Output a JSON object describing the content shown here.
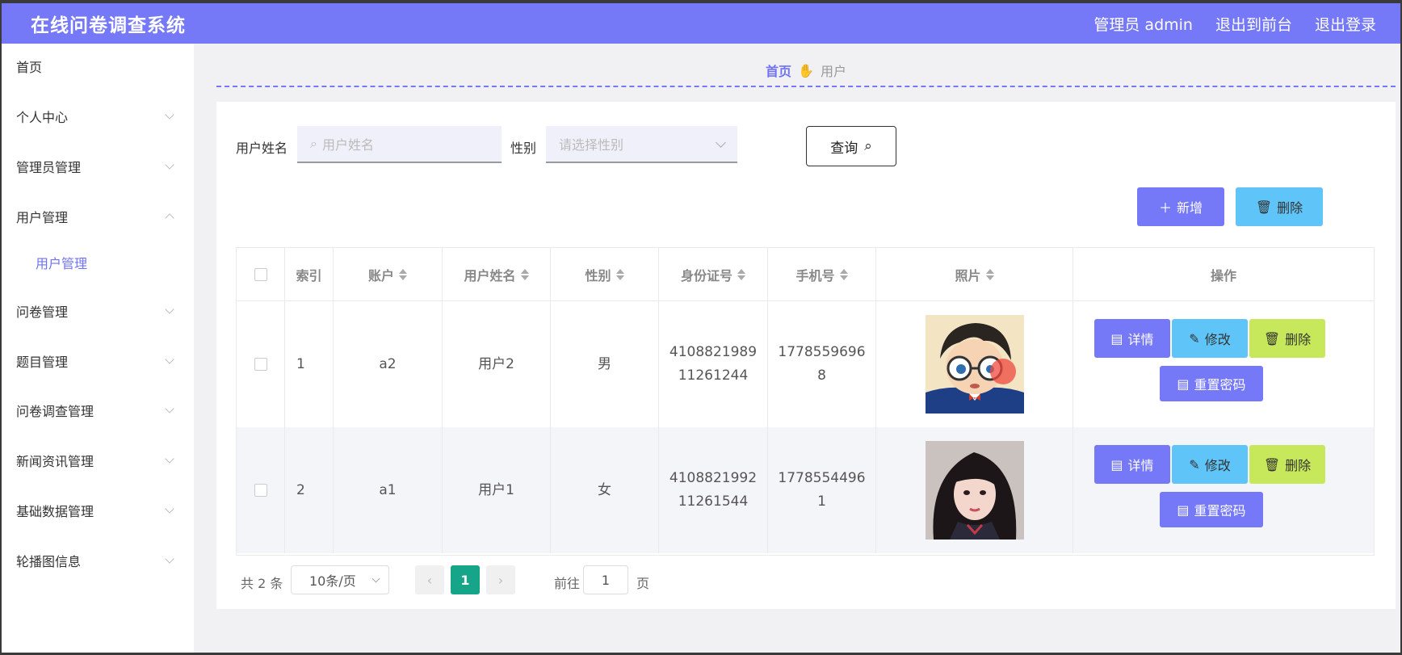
{
  "header": {
    "title": "在线问卷调查系统",
    "admin_label": "管理员 admin",
    "to_front": "退出到前台",
    "logout": "退出登录"
  },
  "sidebar": {
    "items": [
      {
        "label": "首页"
      },
      {
        "label": "个人中心"
      },
      {
        "label": "管理员管理"
      },
      {
        "label": "用户管理",
        "sub": "用户管理"
      },
      {
        "label": "问卷管理"
      },
      {
        "label": "题目管理"
      },
      {
        "label": "问卷调查管理"
      },
      {
        "label": "新闻资讯管理"
      },
      {
        "label": "基础数据管理"
      },
      {
        "label": "轮播图信息"
      }
    ]
  },
  "breadcrumb": {
    "home": "首页",
    "current": "用户"
  },
  "filters": {
    "name_label": "用户姓名",
    "name_placeholder": "用户姓名",
    "gender_label": "性别",
    "gender_placeholder": "请选择性别",
    "query_button": "查询"
  },
  "actions": {
    "add": "新增",
    "delete": "删除"
  },
  "table": {
    "columns": [
      "索引",
      "账户",
      "用户姓名",
      "性别",
      "身份证号",
      "手机号",
      "照片",
      "操作"
    ],
    "rows": [
      {
        "index": "1",
        "account": "a2",
        "name": "用户2",
        "gender": "男",
        "id_line1": "4108821989",
        "id_line2": "11261244",
        "phone_line1": "1778559696",
        "phone_line2": "8",
        "photo": "anime-boy-avatar"
      },
      {
        "index": "2",
        "account": "a1",
        "name": "用户1",
        "gender": "女",
        "id_line1": "4108821992",
        "id_line2": "11261544",
        "phone_line1": "1778554496",
        "phone_line2": "1",
        "photo": "girl-avatar"
      }
    ],
    "row_actions": {
      "detail": "详情",
      "edit": "修改",
      "delete": "删除",
      "reset_password": "重置密码"
    }
  },
  "pagination": {
    "total": "共 2 条",
    "page_size": "10条/页",
    "current_page": "1",
    "goto_label": "前往",
    "goto_value": "1",
    "goto_unit": "页"
  },
  "colors": {
    "header": "#7578f7",
    "primary": "#7578f7",
    "sky": "#5fc4f7",
    "lime": "#c7e85a",
    "page_active": "#17a58a"
  }
}
